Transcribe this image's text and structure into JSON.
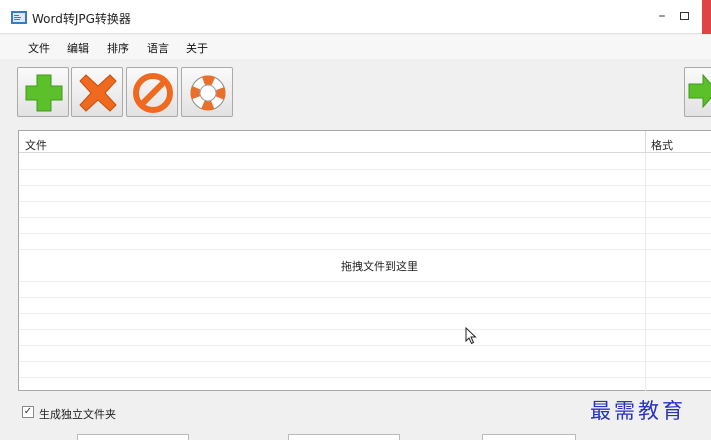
{
  "window": {
    "title": "Word转JPG转换器",
    "minimize_glyph": "–"
  },
  "menu": [
    "文件",
    "编辑",
    "排序",
    "语言",
    "关于"
  ],
  "toolbar": {
    "buttons": [
      {
        "name": "add-button",
        "icon": "plus-icon",
        "color": "#5cc02a"
      },
      {
        "name": "remove-button",
        "icon": "x-icon",
        "color": "#ef6a1f"
      },
      {
        "name": "clear-button",
        "icon": "prohibit-icon",
        "color": "#ef6a1f"
      },
      {
        "name": "help-button",
        "icon": "lifebuoy-icon",
        "color": "#e8702a"
      }
    ]
  },
  "filelist": {
    "columns": [
      "文件",
      "格式"
    ],
    "drop_hint": "拖拽文件到这里"
  },
  "options": {
    "create_subfolder_label": "生成独立文件夹",
    "create_subfolder_checked": true,
    "check_glyph": "✓"
  },
  "watermark": "最需教育"
}
